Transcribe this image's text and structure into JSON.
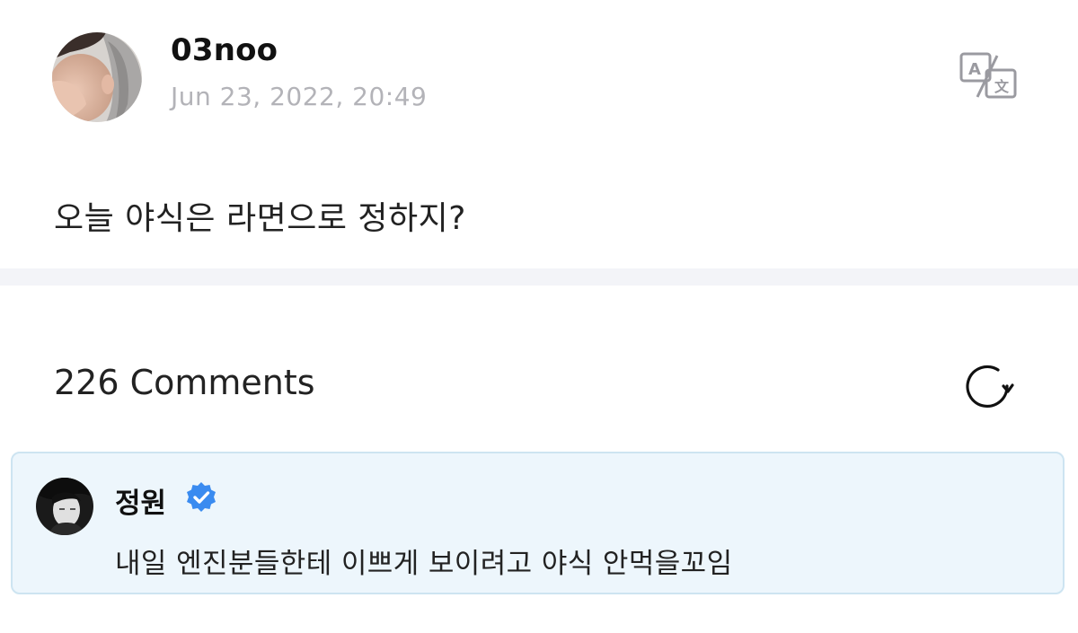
{
  "post": {
    "author": "03noo",
    "date": "Jun 23, 2022, 20:49",
    "text": "오늘 야식은 라면으로 정하지?"
  },
  "comments": {
    "count_label": "226 Comments",
    "highlighted": {
      "author": "정원",
      "verified": true,
      "text": "내일 엔진분들한테 이쁘게 보이려고 야식 안먹을꼬임"
    }
  },
  "icons": {
    "translate": "translate-icon",
    "refresh": "refresh-icon",
    "verified": "verified-badge-icon"
  },
  "colors": {
    "date_gray": "#b3b3b8",
    "comment_bg": "#edf6fc",
    "comment_border": "#cde4f1",
    "verified_blue": "#3a8bf0",
    "divider": "#f3f4f8"
  }
}
